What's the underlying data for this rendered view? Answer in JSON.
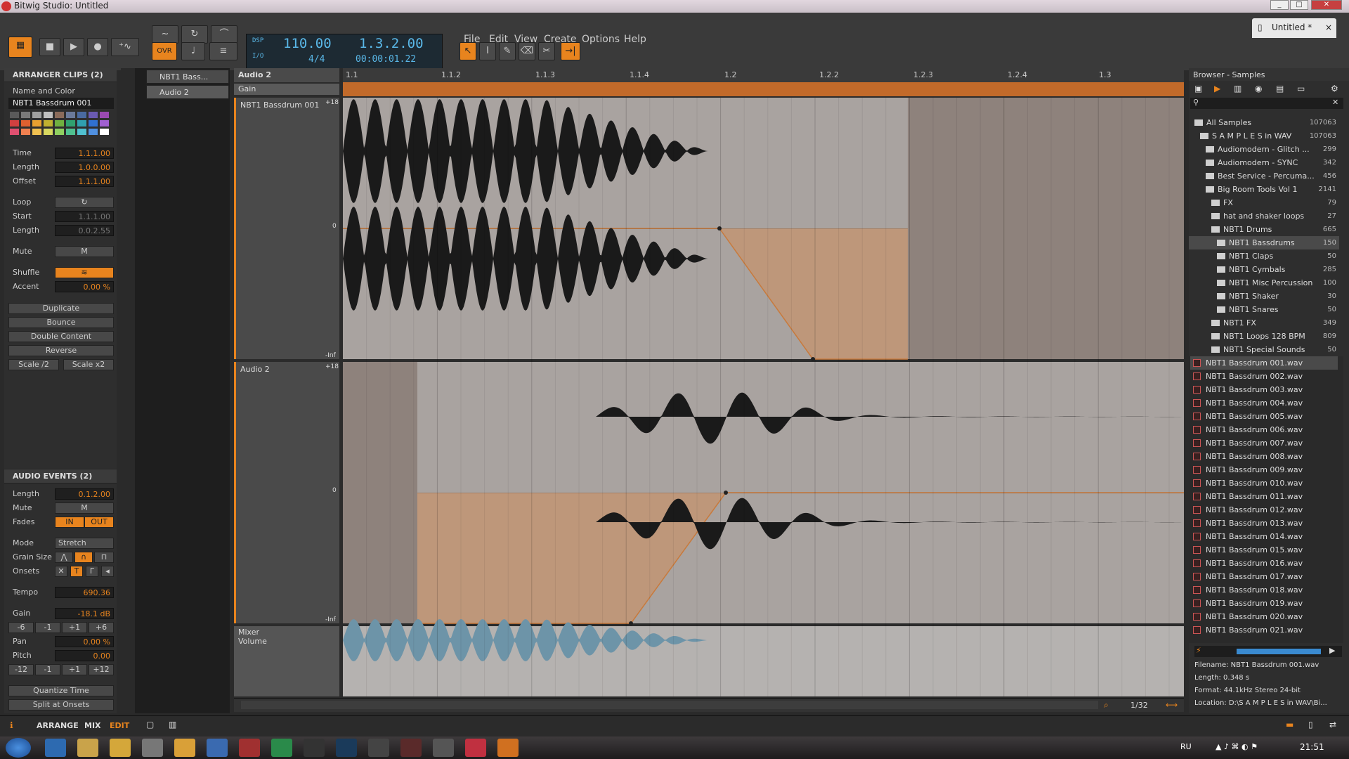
{
  "window": {
    "title": "Bitwig Studio: Untitled"
  },
  "transport": {
    "tempo": "110.00",
    "position": "1.3.2.00",
    "signature": "4/4",
    "time": "00:00:01.22",
    "dsp_label": "DSP",
    "io_label": "I/O",
    "ovr_label": "OVR"
  },
  "menu": [
    "File",
    "Edit",
    "View",
    "Create",
    "Options",
    "Help"
  ],
  "doc_tab": {
    "label": "Untitled *",
    "close": "×"
  },
  "inspector_clips": {
    "header": "ARRANGER CLIPS (2)",
    "name_and_color_label": "Name and Color",
    "clip_name": "NBT1 Bassdrum 001",
    "time_label": "Time",
    "time": "1.1.1.00",
    "length_label": "Length",
    "length": "1.0.0.00",
    "offset_label": "Offset",
    "offset": "1.1.1.00",
    "loop_label": "Loop",
    "start_label": "Start",
    "start": "1.1.1.00",
    "loop_length_label": "Length",
    "loop_length": "0.0.2.55",
    "mute_label": "Mute",
    "mute_btn": "M",
    "shuffle_label": "Shuffle",
    "accent_label": "Accent",
    "accent": "0.00 %",
    "duplicate": "Duplicate",
    "bounce": "Bounce",
    "double_content": "Double Content",
    "reverse": "Reverse",
    "scale_half": "Scale /2",
    "scale_double": "Scale x2"
  },
  "inspector_events": {
    "header": "AUDIO EVENTS (2)",
    "length_label": "Length",
    "length": "0.1.2.00",
    "mute_label": "Mute",
    "mute_btn": "M",
    "fades_label": "Fades",
    "fade_in": "IN",
    "fade_out": "OUT",
    "mode_label": "Mode",
    "mode": "Stretch",
    "grain_label": "Grain Size",
    "onsets_label": "Onsets",
    "tempo_label": "Tempo",
    "tempo": "690.36",
    "gain_label": "Gain",
    "gain": "-18.1 dB",
    "gain_steps": [
      "-6",
      "-1",
      "+1",
      "+6"
    ],
    "pan_label": "Pan",
    "pan": "0.00 %",
    "pitch_label": "Pitch",
    "pitch": "0.00",
    "pitch_steps": [
      "-12",
      "-1",
      "+1",
      "+12"
    ],
    "quantize_time": "Quantize Time",
    "split_onsets": "Split at Onsets"
  },
  "tracks": [
    "NBT1 Bass...",
    "Audio 2"
  ],
  "editor": {
    "track_title": "Audio 2",
    "param": "Gain",
    "lane1": "NBT1 Bassdrum 001",
    "lane2": "Audio 2",
    "mixer": "Mixer",
    "volume": "Volume",
    "scale_top": "+18",
    "scale_mid": "0",
    "scale_bot": "-Inf",
    "ruler": [
      "1.1",
      "1.1.2",
      "1.1.3",
      "1.1.4",
      "1.2",
      "1.2.2",
      "1.2.3",
      "1.2.4",
      "1.3"
    ],
    "grid": "1/32"
  },
  "browser": {
    "title": "Browser - Samples",
    "tree": [
      {
        "label": "All Samples",
        "count": "107063",
        "indent": 0
      },
      {
        "label": "S A M P L E S in WAV",
        "count": "107063",
        "indent": 1
      },
      {
        "label": "Audiomodern - Glitch ...",
        "count": "299",
        "indent": 2
      },
      {
        "label": "Audiomodern - SYNC",
        "count": "342",
        "indent": 2
      },
      {
        "label": "Best Service - Percuma...",
        "count": "456",
        "indent": 2
      },
      {
        "label": "Big Room Tools Vol 1",
        "count": "2141",
        "indent": 2
      },
      {
        "label": "FX",
        "count": "79",
        "indent": 3
      },
      {
        "label": "hat and shaker loops",
        "count": "27",
        "indent": 3
      },
      {
        "label": "NBT1 Drums",
        "count": "665",
        "indent": 3
      },
      {
        "label": "NBT1 Bassdrums",
        "count": "150",
        "indent": 4
      },
      {
        "label": "NBT1 Claps",
        "count": "50",
        "indent": 4
      },
      {
        "label": "NBT1 Cymbals",
        "count": "285",
        "indent": 4
      },
      {
        "label": "NBT1 Misc Percussion",
        "count": "100",
        "indent": 4
      },
      {
        "label": "NBT1 Shaker",
        "count": "30",
        "indent": 4
      },
      {
        "label": "NBT1 Snares",
        "count": "50",
        "indent": 4
      },
      {
        "label": "NBT1 FX",
        "count": "349",
        "indent": 3
      },
      {
        "label": "NBT1 Loops 128 BPM",
        "count": "809",
        "indent": 3
      },
      {
        "label": "NBT1 Special Sounds",
        "count": "50",
        "indent": 3
      }
    ],
    "files": [
      "NBT1 Bassdrum 001.wav",
      "NBT1 Bassdrum 002.wav",
      "NBT1 Bassdrum 003.wav",
      "NBT1 Bassdrum 004.wav",
      "NBT1 Bassdrum 005.wav",
      "NBT1 Bassdrum 006.wav",
      "NBT1 Bassdrum 007.wav",
      "NBT1 Bassdrum 008.wav",
      "NBT1 Bassdrum 009.wav",
      "NBT1 Bassdrum 010.wav",
      "NBT1 Bassdrum 011.wav",
      "NBT1 Bassdrum 012.wav",
      "NBT1 Bassdrum 013.wav",
      "NBT1 Bassdrum 014.wav",
      "NBT1 Bassdrum 015.wav",
      "NBT1 Bassdrum 016.wav",
      "NBT1 Bassdrum 017.wav",
      "NBT1 Bassdrum 018.wav",
      "NBT1 Bassdrum 019.wav",
      "NBT1 Bassdrum 020.wav",
      "NBT1 Bassdrum 021.wav"
    ],
    "info_filename": "Filename: NBT1 Bassdrum 001.wav",
    "info_length": "Length: 0.348 s",
    "info_format": "Format: 44.1kHz Stereo 24-bit",
    "info_location": "Location: D:\\S A M P L E S in WAV\\Bi..."
  },
  "status": {
    "arrange": "ARRANGE",
    "mix": "MIX",
    "edit": "EDIT"
  },
  "taskbar": {
    "lang": "RU",
    "clock": "21:51"
  },
  "colors": {
    "accent": "#e8841e",
    "waveform_bg": "#a9a3a0",
    "automation": "#c87a3c"
  }
}
